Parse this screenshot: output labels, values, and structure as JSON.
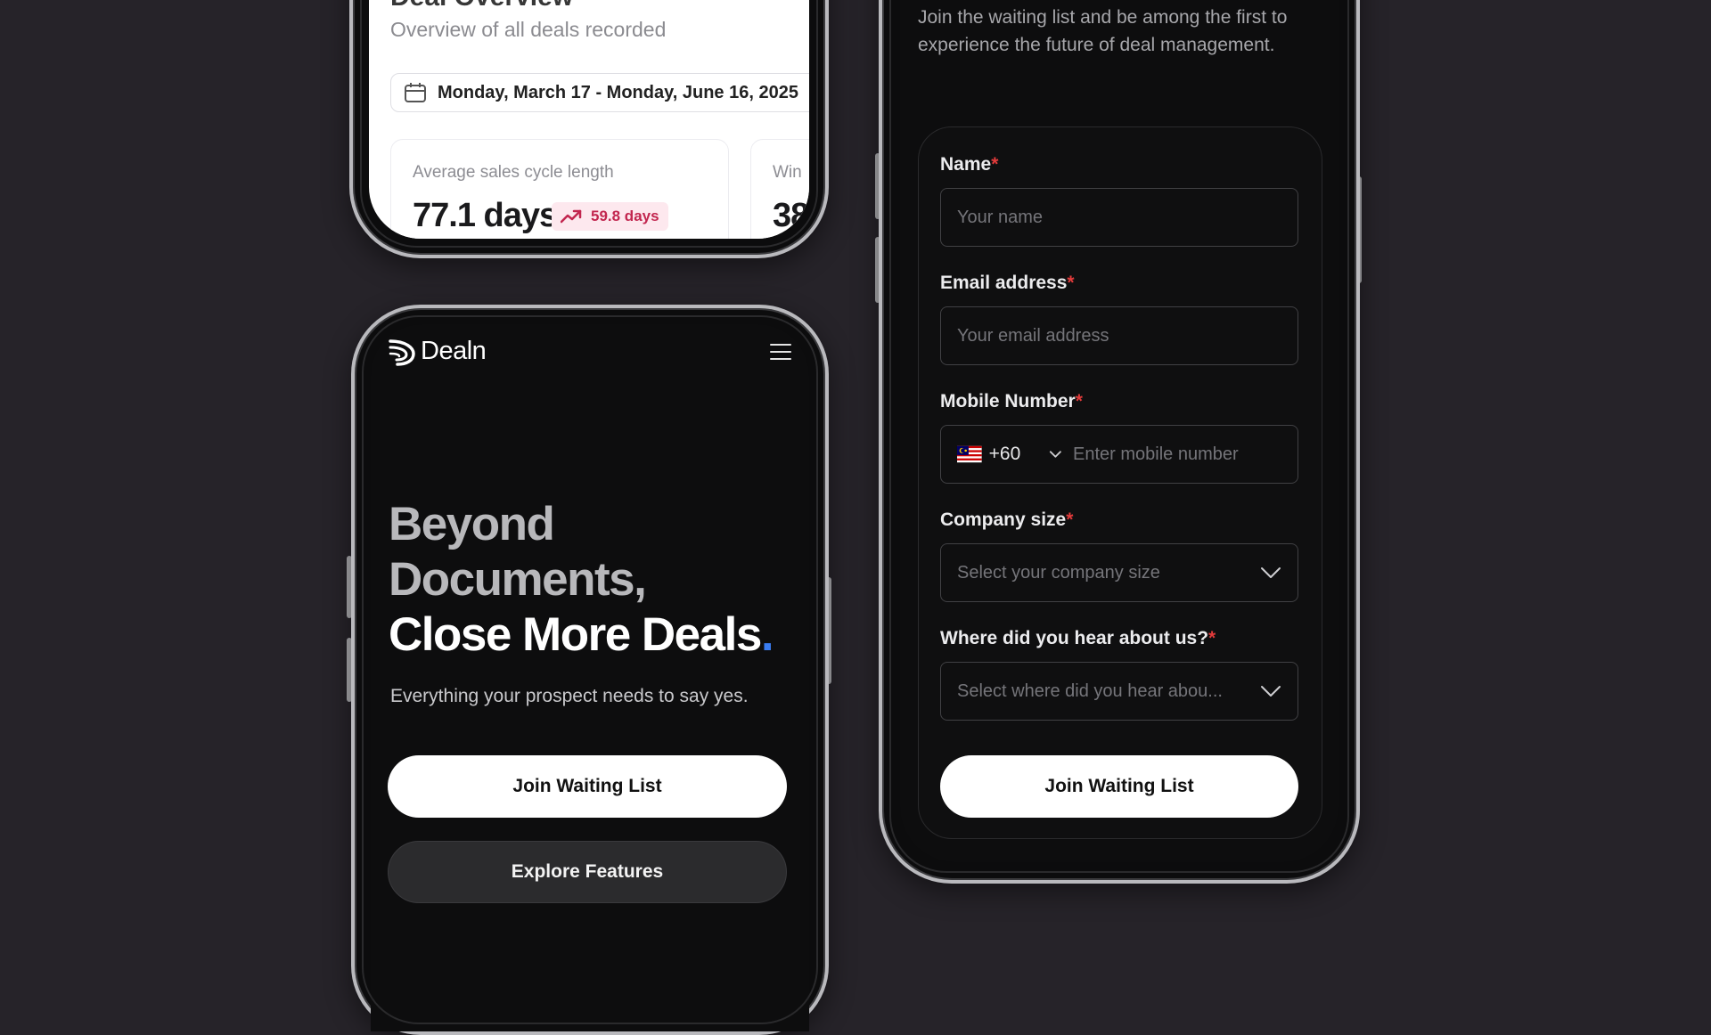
{
  "colors": {
    "background": "#262329",
    "phone_screen": "#0d0d0e",
    "accent_blue": "#3a7df2",
    "required_red": "#e23b3b",
    "badge_red": "#c2264f"
  },
  "dashboard": {
    "title": "Deal Overview",
    "subtitle": "Overview of all deals recorded",
    "date_range": "Monday, March 17 - Monday, June 16, 2025",
    "date_icon": "calendar-icon",
    "cards": [
      {
        "label": "Average sales cycle length",
        "value": "77.1 days",
        "badge": "59.8 days",
        "badge_icon": "trending-up-icon"
      },
      {
        "label": "Win",
        "value": "38"
      }
    ]
  },
  "landing": {
    "brand": "Dealn",
    "logo_icon": "dealn-logo-icon",
    "menu_icon": "hamburger-menu-icon",
    "hero": {
      "line1": "Beyond",
      "line2": "Documents,",
      "line3": "Close More Deals",
      "dot": "."
    },
    "subtitle": "Everything your prospect needs to say yes.",
    "primary_button": "Join Waiting List",
    "secondary_button": "Explore Features"
  },
  "form": {
    "intro": "Join the waiting list and be among the first to experience the future of deal management.",
    "required_mark": "*",
    "name": {
      "label": "Name",
      "placeholder": "Your name"
    },
    "email": {
      "label": "Email address",
      "placeholder": "Your email address"
    },
    "mobile": {
      "label": "Mobile Number",
      "country_flag": "malaysia-flag-icon",
      "country_code": "+60",
      "placeholder": "Enter mobile number"
    },
    "company_size": {
      "label": "Company size",
      "placeholder": "Select your company size"
    },
    "source": {
      "label": "Where did you hear about us?",
      "placeholder": "Select where did you hear abou..."
    },
    "submit": "Join Waiting List"
  }
}
